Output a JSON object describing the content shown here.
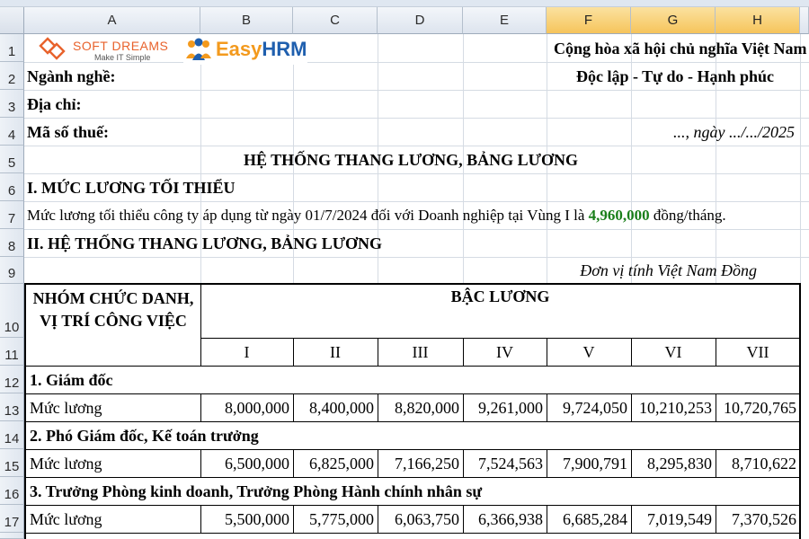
{
  "columns": [
    "A",
    "B",
    "C",
    "D",
    "E",
    "F",
    "G",
    "H"
  ],
  "rows": [
    "1",
    "2",
    "3",
    "4",
    "5",
    "6",
    "7",
    "8",
    "9",
    "10",
    "11",
    "12",
    "13",
    "14",
    "15",
    "16",
    "17"
  ],
  "logos": {
    "softdreams_name": "SOFT DREAMS",
    "softdreams_tagline": "Make IT Simple",
    "easyhrm_easy": "Easy",
    "easyhrm_hrm": "HRM"
  },
  "header": {
    "country": "Cộng hòa xã hội chủ nghĩa Việt Nam",
    "motto": "Độc lập - Tự do - Hạnh phúc",
    "industry": "Ngành nghề:",
    "address": "Địa chỉ:",
    "tax_code": "Mã số thuế:",
    "date": "..., ngày .../.../2025"
  },
  "title": "HỆ THỐNG THANG LƯƠNG, BẢNG LƯƠNG",
  "section1": {
    "heading": "I. MỨC LƯƠNG TỐI THIỂU",
    "text_before": "Mức lương tối thiểu công ty áp dụng từ ngày 01/7/2024 đối với Doanh nghiệp tại Vùng I là ",
    "amount": "4,960,000",
    "text_after": " đồng/tháng."
  },
  "section2": {
    "heading": "II. HỆ THỐNG THANG LƯƠNG, BẢNG LƯƠNG",
    "unit": "Đơn vị tính Việt Nam Đồng"
  },
  "table": {
    "group_header_line1": "NHÓM CHỨC DANH,",
    "group_header_line2": "VỊ TRÍ CÔNG VIỆC",
    "grade_header": "BẬC LƯƠNG",
    "grades": [
      "I",
      "II",
      "III",
      "IV",
      "V",
      "VI",
      "VII"
    ],
    "groups": [
      {
        "title": "1. Giám đốc",
        "label": "Mức lương",
        "values": [
          "8,000,000",
          "8,400,000",
          "8,820,000",
          "9,261,000",
          "9,724,050",
          "10,210,253",
          "10,720,765"
        ]
      },
      {
        "title": "2. Phó Giám đốc, Kế toán trưởng",
        "label": "Mức lương",
        "values": [
          "6,500,000",
          "6,825,000",
          "7,166,250",
          "7,524,563",
          "7,900,791",
          "8,295,830",
          "8,710,622"
        ]
      },
      {
        "title": "3. Trưởng Phòng kinh doanh, Trưởng Phòng Hành chính nhân sự",
        "label": "Mức lương",
        "values": [
          "5,500,000",
          "5,775,000",
          "6,063,750",
          "6,366,938",
          "6,685,284",
          "7,019,549",
          "7,370,526"
        ]
      }
    ]
  },
  "colors": {
    "accent_green": "#1a7f1a",
    "selected_header": "#f6c45b",
    "softdreams_orange": "#e8622c",
    "easyhrm_blue": "#1f5fae",
    "easyhrm_orange": "#f39a1e"
  }
}
